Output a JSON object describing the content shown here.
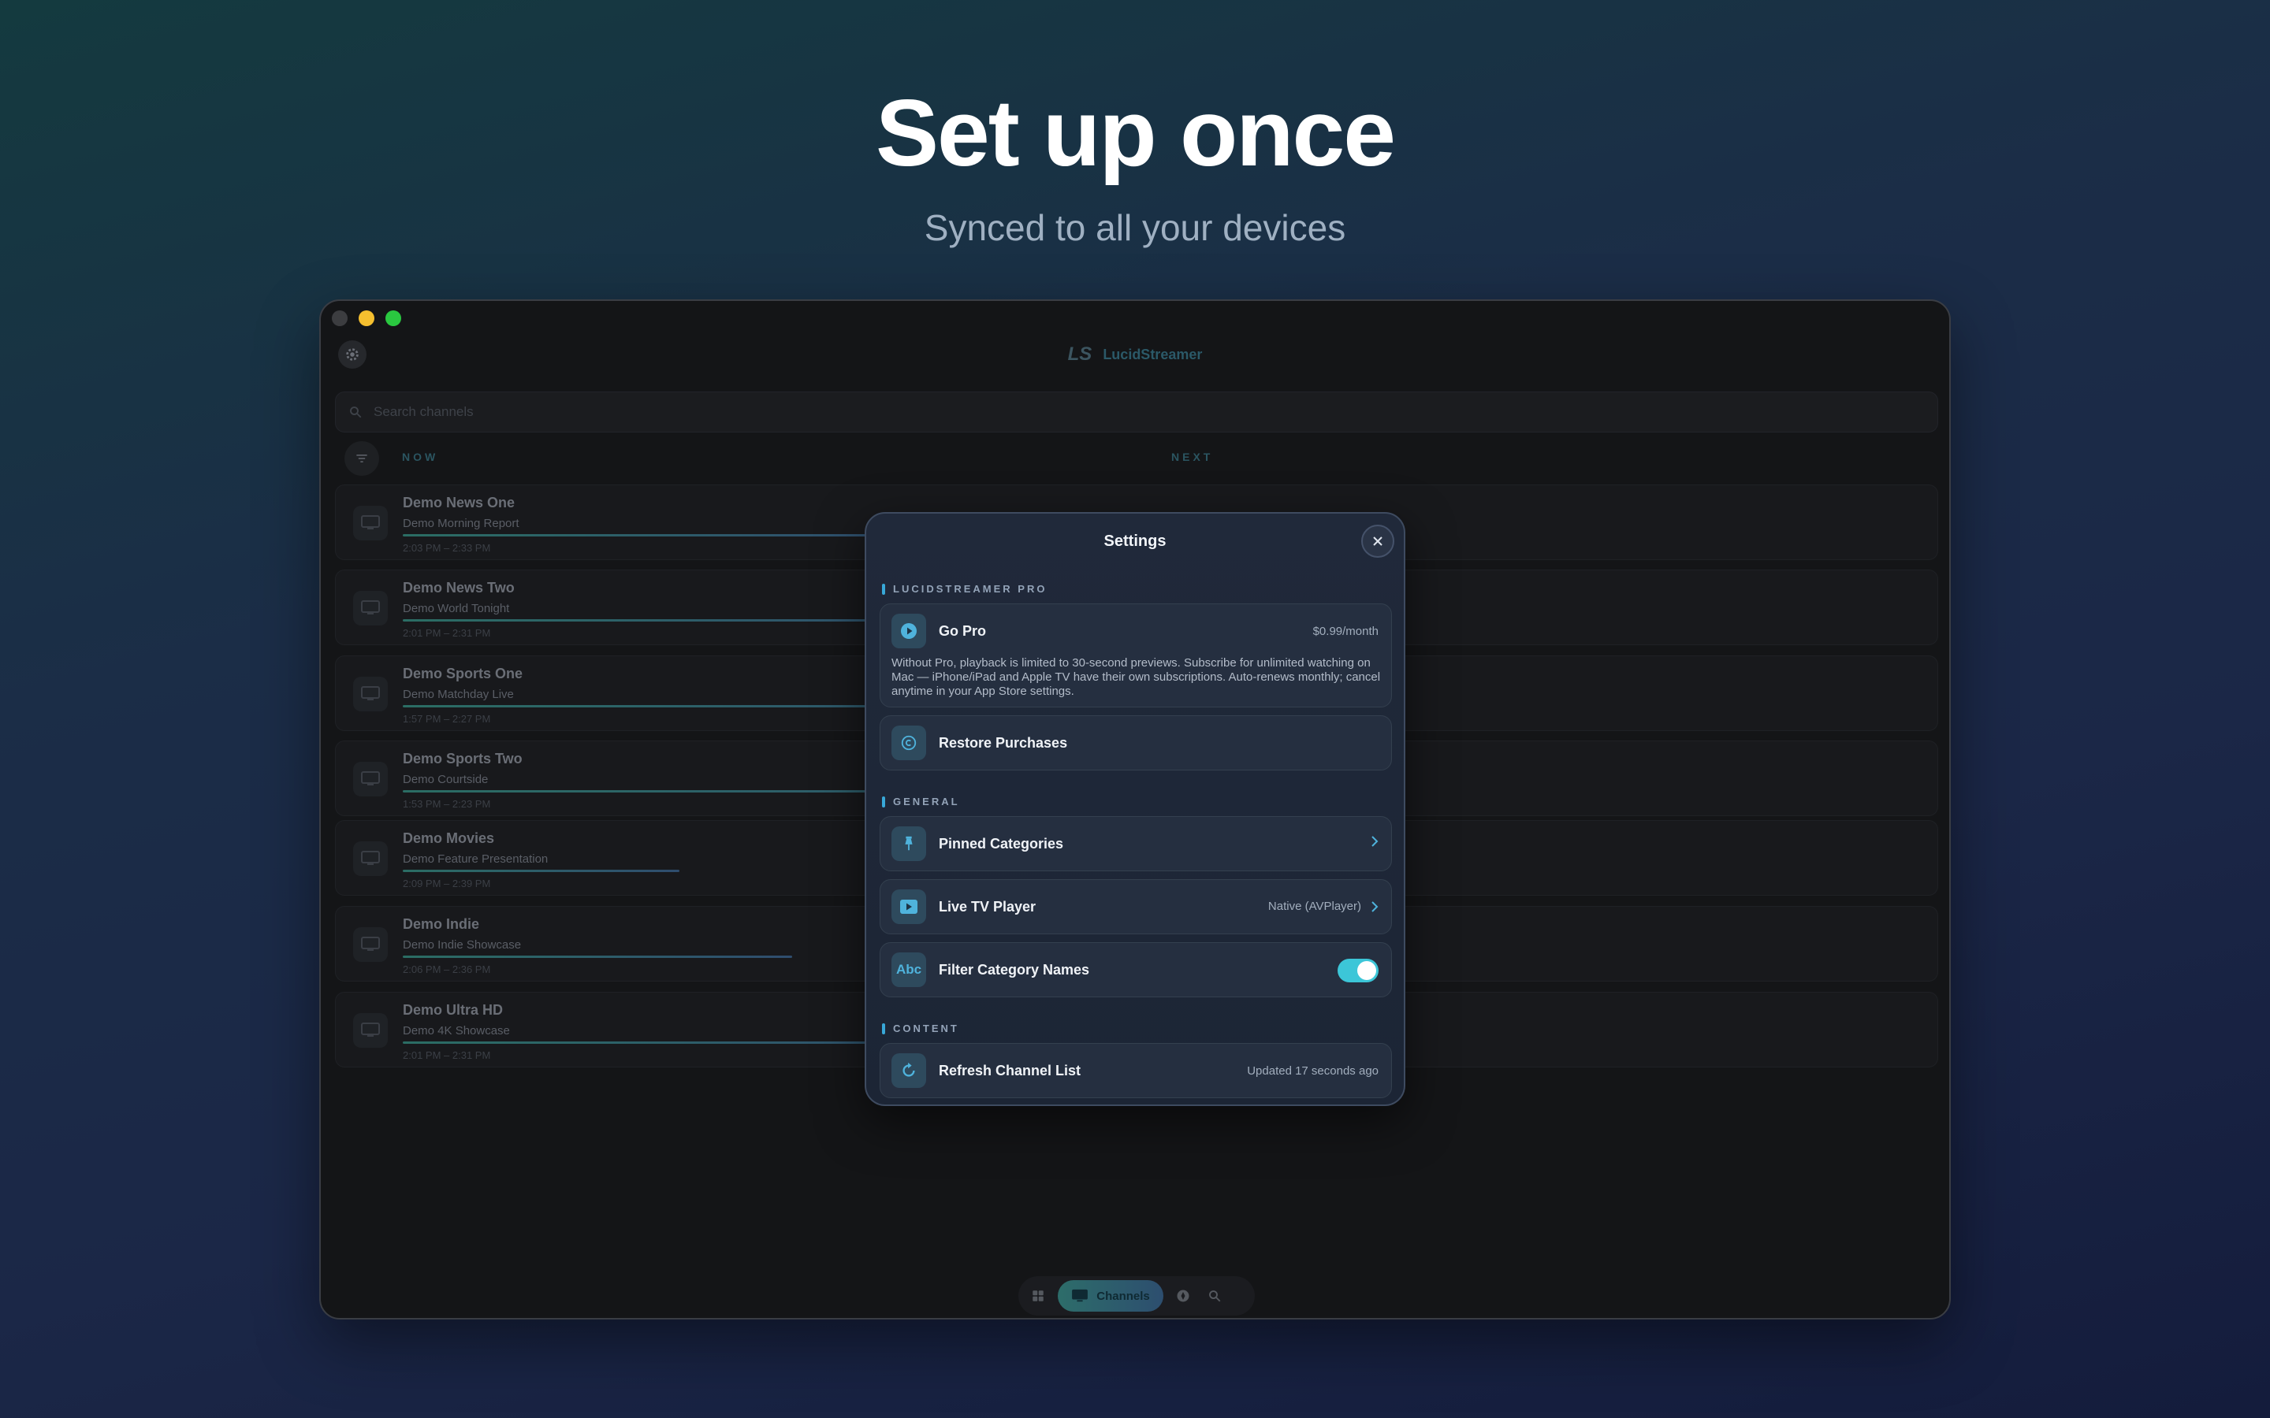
{
  "hero": {
    "title": "Set up once",
    "subtitle": "Synced to all your devices"
  },
  "app": {
    "name": "LucidStreamer",
    "logo_text": "LS",
    "search": {
      "placeholder": "Search channels"
    },
    "columns": {
      "now": "NOW",
      "next": "NEXT"
    },
    "channels": [
      {
        "name": "Demo News One",
        "show": "Demo Morning Report",
        "time": "2:03 PM – 2:33 PM",
        "progress": 0.49
      },
      {
        "name": "Demo News Two",
        "show": "Demo World Tonight",
        "time": "2:01 PM – 2:31 PM",
        "progress": 0.56
      },
      {
        "name": "Demo Sports One",
        "show": "Demo Matchday Live",
        "time": "1:57 PM – 2:27 PM",
        "progress": 0.7
      },
      {
        "name": "Demo Sports Two",
        "show": "Demo Courtside",
        "time": "1:53 PM – 2:23 PM",
        "progress": 0.85
      },
      {
        "name": "Demo Movies",
        "show": "Demo Feature Presentation",
        "time": "2:09 PM – 2:39 PM",
        "progress": 0.27
      },
      {
        "name": "Demo Indie",
        "show": "Demo Indie Showcase",
        "time": "2:06 PM – 2:36 PM",
        "progress": 0.38
      },
      {
        "name": "Demo Ultra HD",
        "show": "Demo 4K Showcase",
        "time": "2:01 PM – 2:31 PM",
        "progress": 0.56
      }
    ],
    "tabs": {
      "active_label": "Channels"
    }
  },
  "settings": {
    "title": "Settings",
    "sections": {
      "pro": "LUCIDSTREAMER PRO",
      "general": "GENERAL",
      "content": "CONTENT"
    },
    "go_pro": {
      "label": "Go Pro",
      "price": "$0.99/month",
      "description": "Without Pro, playback is limited to 30-second previews. Subscribe for unlimited watching on Mac — iPhone/iPad and Apple TV have their own subscriptions. Auto-renews monthly; cancel anytime in your App Store settings."
    },
    "restore": {
      "label": "Restore Purchases"
    },
    "pinned": {
      "label": "Pinned Categories"
    },
    "player": {
      "label": "Live TV Player",
      "value": "Native (AVPlayer)"
    },
    "filter": {
      "label": "Filter Category Names",
      "icon_text": "Abc",
      "enabled": true
    },
    "refresh": {
      "label": "Refresh Channel List",
      "status": "Updated 17 seconds ago"
    }
  },
  "colors": {
    "accent": "#38a8d8",
    "toggle_on": "#3cc6d8",
    "traffic_min": "#f5bf2f",
    "traffic_max": "#2ac840"
  }
}
